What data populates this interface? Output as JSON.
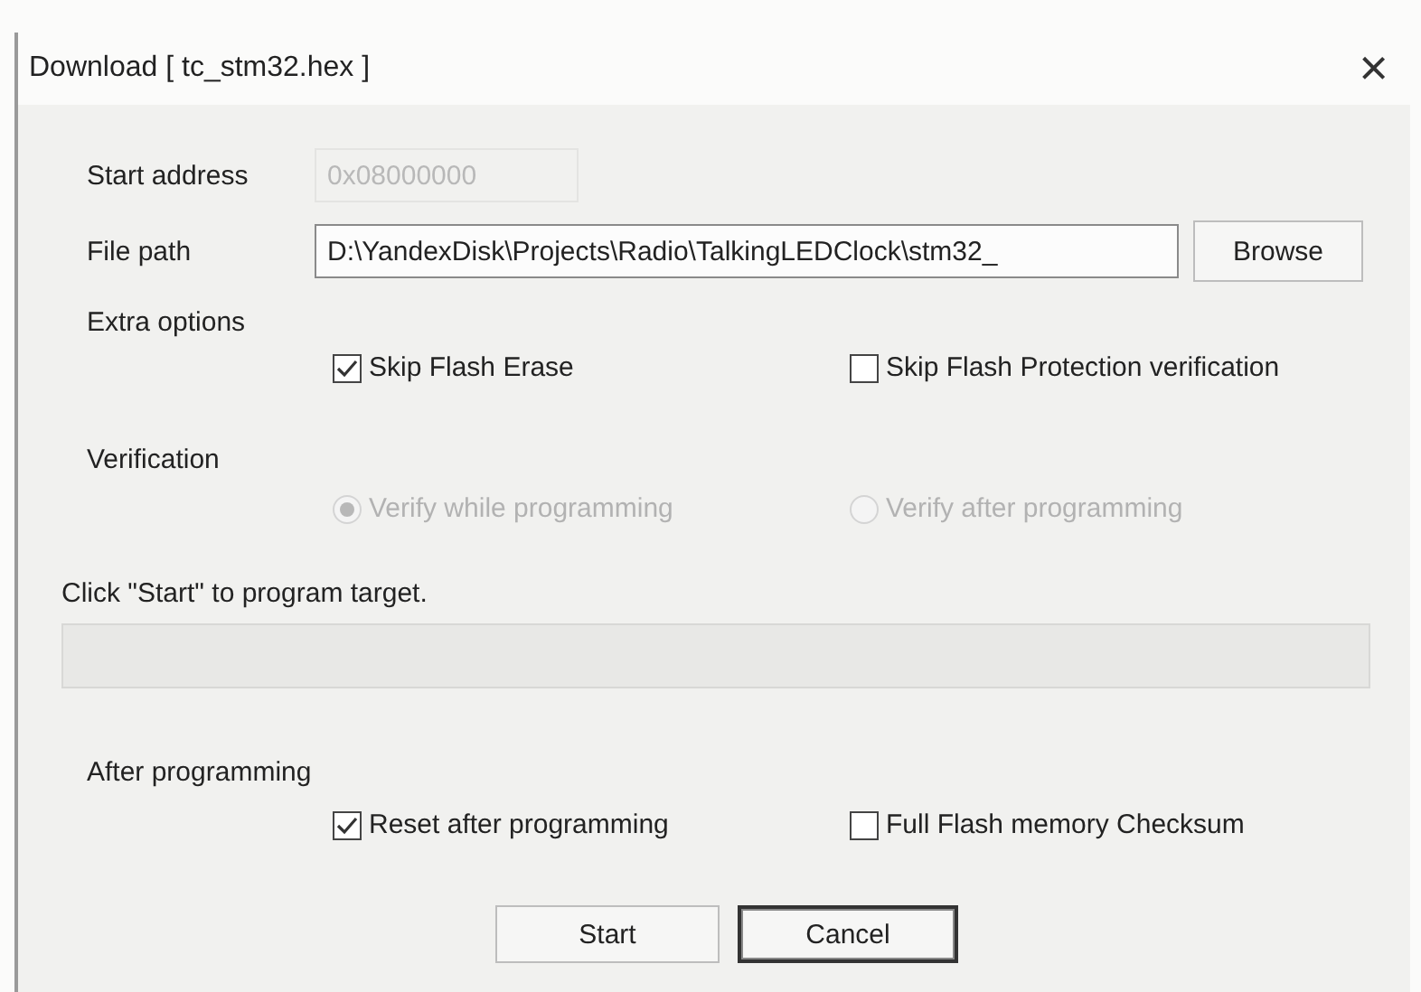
{
  "window": {
    "title": "Download [ tc_stm32.hex ]",
    "close": "×"
  },
  "start_address": {
    "label": "Start address",
    "value": "0x08000000",
    "disabled": true
  },
  "file_path": {
    "label": "File path",
    "value": "D:\\YandexDisk\\Projects\\Radio\\TalkingLEDClock\\stm32_",
    "button": "Browse"
  },
  "extra_options": {
    "label": "Extra options",
    "options": [
      {
        "label": "Skip Flash Erase",
        "checked": true
      },
      {
        "label": "Skip Flash Protection verification",
        "checked": false
      }
    ]
  },
  "verification": {
    "label": "Verification",
    "options": [
      {
        "label": "Verify while programming",
        "selected": true,
        "disabled": true
      },
      {
        "label": "Verify after programming",
        "selected": false,
        "disabled": true
      }
    ]
  },
  "status": {
    "text": "Click \"Start\" to program target."
  },
  "after_programming": {
    "label": "After programming",
    "options": [
      {
        "label": "Reset after programming",
        "checked": true
      },
      {
        "label": "Full Flash memory Checksum",
        "checked": false
      }
    ]
  },
  "buttons": [
    {
      "label": "Start",
      "focused": false
    },
    {
      "label": "Cancel",
      "focused": true
    }
  ]
}
